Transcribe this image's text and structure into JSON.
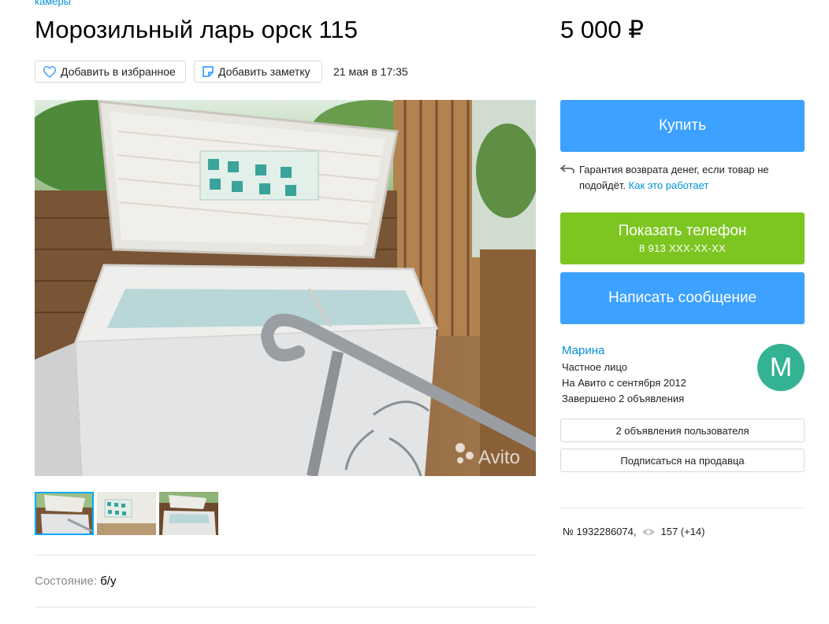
{
  "breadcrumb": "камеры",
  "listing": {
    "title": "Морозильный ларь орск 115",
    "price": "5 000 ₽",
    "favorite_label": "Добавить в избранное",
    "note_label": "Добавить заметку",
    "date": "21 мая в 17:35",
    "condition_label": "Состояние:",
    "condition_value": "б/у",
    "watermark": "Avito"
  },
  "actions": {
    "buy_label": "Купить",
    "guarantee_text": "Гарантия возврата денег, если товар не подойдёт.",
    "guarantee_link": "Как это работает",
    "show_phone_label": "Показать телефон",
    "phone_masked": "8 913 XXX-XX-XX",
    "message_label": "Написать сообщение"
  },
  "seller": {
    "name": "Марина",
    "type": "Частное лицо",
    "since": "На Авито с сентября 2012",
    "completed": "Завершено 2 объявления",
    "avatar_letter": "М",
    "avatar_color": "#34b394",
    "listings_button": "2 объявления пользователя",
    "subscribe_button": "Подписаться на продавца"
  },
  "stats": {
    "ad_number": "№ 1932286074,",
    "views": "157 (+14)"
  },
  "colors": {
    "link": "#0091d9",
    "buy": "#3ca1ff",
    "phone": "#7dc621",
    "message": "#3ca1ff"
  }
}
